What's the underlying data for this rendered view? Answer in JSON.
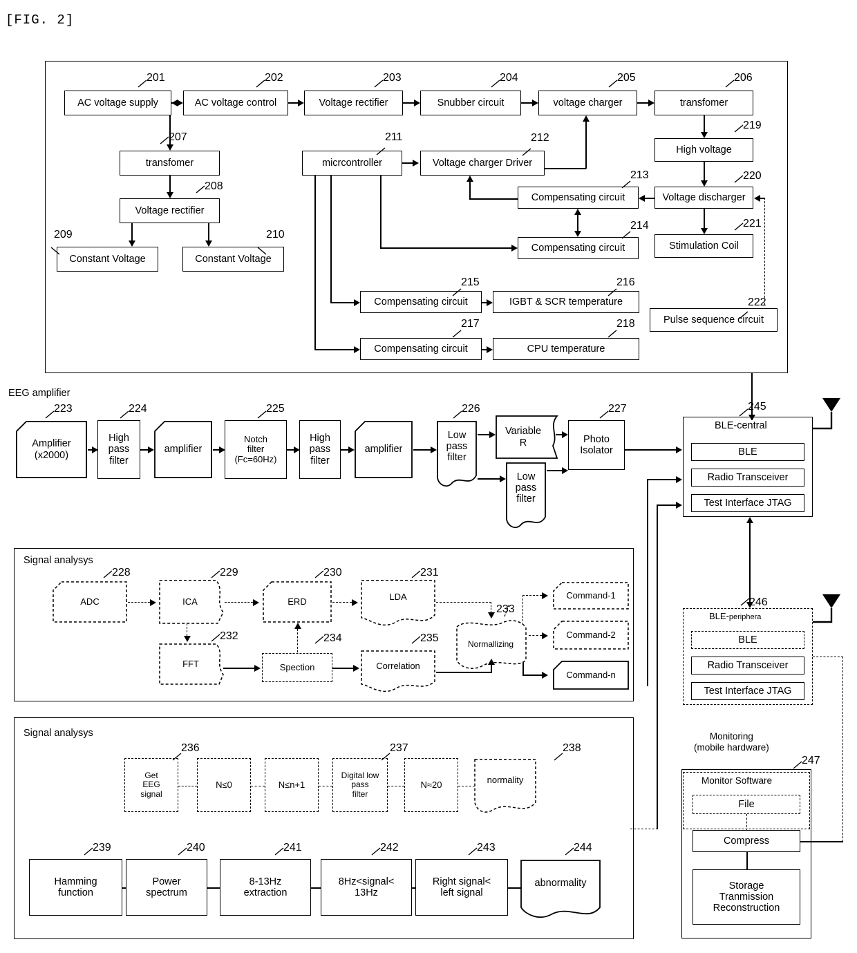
{
  "figure": {
    "title": "[FIG. 2]"
  },
  "power_panel": {
    "blocks": [
      {
        "id": "201",
        "label": "AC voltage supply"
      },
      {
        "id": "202",
        "label": "AC voltage control"
      },
      {
        "id": "203",
        "label": "Voltage rectifier"
      },
      {
        "id": "204",
        "label": "Snubber circuit"
      },
      {
        "id": "205",
        "label": "voltage charger"
      },
      {
        "id": "206",
        "label": "transfomer"
      },
      {
        "id": "207",
        "label": "transfomer"
      },
      {
        "id": "208",
        "label": "Voltage rectifier"
      },
      {
        "id": "209",
        "label": "Constant Voltage"
      },
      {
        "id": "210",
        "label": "Constant Voltage"
      },
      {
        "id": "211",
        "label": "micrcontroller"
      },
      {
        "id": "212",
        "label": "Voltage charger Driver"
      },
      {
        "id": "213",
        "label": "Compensating circuit"
      },
      {
        "id": "214",
        "label": "Compensating circuit"
      },
      {
        "id": "215",
        "label": "Compensating circuit"
      },
      {
        "id": "216",
        "label": "IGBT & SCR temperature"
      },
      {
        "id": "217",
        "label": "Compensating circuit"
      },
      {
        "id": "218",
        "label": "CPU temperature"
      },
      {
        "id": "219",
        "label": "High voltage"
      },
      {
        "id": "220",
        "label": "Voltage discharger"
      },
      {
        "id": "221",
        "label": "Stimulation Coil"
      },
      {
        "id": "222",
        "label": "Pulse sequence circuit"
      }
    ]
  },
  "eeg_amplifier": {
    "section_label": "EEG amplifier",
    "blocks": [
      {
        "id": "223",
        "label": "Amplifier\n(x2000)"
      },
      {
        "id": "224",
        "label": "High\npass\nfilter"
      },
      {
        "id": "",
        "label": "amplifier"
      },
      {
        "id": "225",
        "label": "Notch\nfilter\n(Fc=60Hz)"
      },
      {
        "id": "",
        "label": "High\npass\nfilter"
      },
      {
        "id": "",
        "label": "amplifier"
      },
      {
        "id": "226",
        "label": "Low\npass\nfilter"
      },
      {
        "id": "",
        "label": "Variable\nR"
      },
      {
        "id": "",
        "label": "Low\npass\nfilter"
      },
      {
        "id": "227",
        "label": "Photo\nIsolator"
      }
    ]
  },
  "signal_analysis_1": {
    "section_label": "Signal analysys",
    "blocks": [
      {
        "id": "228",
        "label": "ADC"
      },
      {
        "id": "229",
        "label": "ICA"
      },
      {
        "id": "230",
        "label": "ERD"
      },
      {
        "id": "231",
        "label": "LDA"
      },
      {
        "id": "232",
        "label": "FFT"
      },
      {
        "id": "233",
        "label": "Normallizing"
      },
      {
        "id": "234",
        "label": "Spection"
      },
      {
        "id": "235",
        "label": "Correlation"
      },
      {
        "id": "",
        "label": "Command-1"
      },
      {
        "id": "",
        "label": "Command-2"
      },
      {
        "id": "",
        "label": "Command-n"
      }
    ]
  },
  "signal_analysis_2": {
    "section_label": "Signal analysys",
    "blocks": [
      {
        "id": "236",
        "label": "Get\nEEG\nsignal"
      },
      {
        "id": "",
        "label": "N≤0"
      },
      {
        "id": "",
        "label": "N≤n+1"
      },
      {
        "id": "237",
        "label": "Digital low\npass\nfilter"
      },
      {
        "id": "",
        "label": "N≈20"
      },
      {
        "id": "238",
        "label": "normality"
      },
      {
        "id": "239",
        "label": "Hamming\nfunction"
      },
      {
        "id": "240",
        "label": "Power\nspectrum"
      },
      {
        "id": "241",
        "label": "8-13Hz\nextraction"
      },
      {
        "id": "242",
        "label": "8Hz<signal<\n13Hz"
      },
      {
        "id": "243",
        "label": "Right signal<\nleft signal"
      },
      {
        "id": "244",
        "label": "abnormality"
      }
    ]
  },
  "ble_central": {
    "id": "245",
    "title": "BLE-central",
    "rows": [
      "BLE",
      "Radio Transceiver",
      "Test Interface JTAG"
    ]
  },
  "ble_peripheral": {
    "id": "246",
    "title_main": "BLE-",
    "title_sub": "periphera",
    "rows": [
      "BLE",
      "Radio Transceiver",
      "Test Interface JTAG"
    ]
  },
  "monitoring": {
    "id": "247",
    "heading": "Monitoring\n(mobile hardware)",
    "software_label": "Monitor Software",
    "rows": [
      "File",
      "Compress",
      "Storage\nTranmission\nReconstruction"
    ]
  }
}
